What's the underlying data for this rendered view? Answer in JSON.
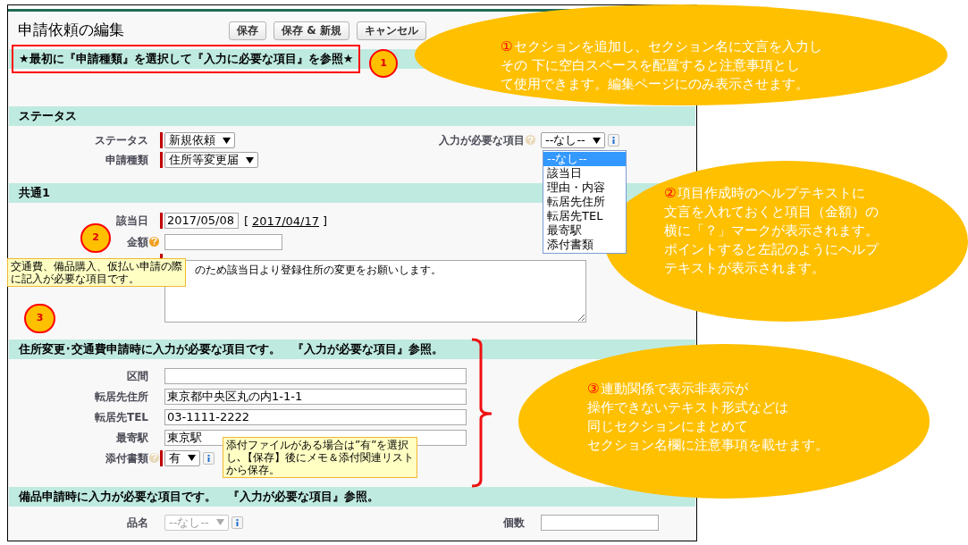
{
  "header": {
    "title": "申請依頼の編集",
    "buttons": [
      "保存",
      "保存 & 新規",
      "キャンセル"
    ]
  },
  "sections": [
    {
      "title": "★最初に『申請種類』を選択して『入力に必要な項目』を参照★",
      "highlighted": true,
      "blank_space": true
    },
    {
      "title": "ステータス",
      "highlighted": false,
      "rows": [
        {
          "left": {
            "label": "ステータス",
            "kind": "select",
            "value": "新規依頼",
            "required": true
          },
          "right": {
            "label": "入力が必要な項目",
            "kind": "select",
            "value": "--なし--",
            "help": true,
            "help_hovered": false,
            "info": true,
            "open": true,
            "options": [
              {
                "label": "--なし--",
                "selected": true
              },
              {
                "label": "該当日",
                "selected": false
              },
              {
                "label": "理由・内容",
                "selected": false
              },
              {
                "label": "転居先住所",
                "selected": false
              },
              {
                "label": "転居先TEL",
                "selected": false
              },
              {
                "label": "最寄駅",
                "selected": false
              },
              {
                "label": "添付書類",
                "selected": false
              }
            ]
          }
        },
        {
          "left": {
            "label": "申請種類",
            "kind": "select",
            "value": "住所等変更届",
            "required": true
          }
        }
      ]
    },
    {
      "title": "共通1",
      "highlighted": false,
      "rows": [
        {
          "left": {
            "label": "該当日",
            "kind": "date",
            "value": "2017/05/08",
            "required": true,
            "link": {
              "open": "[",
              "text": "2017/04/17",
              "close": "]"
            }
          }
        },
        {
          "left": {
            "label": "金額",
            "kind": "text",
            "help": true,
            "help_hovered": true
          }
        },
        {
          "left": {
            "kind": "textarea",
            "value": "のため該当日より登録住所の変更をお願いします。",
            "required": true
          }
        }
      ]
    },
    {
      "title": "住所変更･交通費申請時に入力が必要な項目です。　『入力が必要な項目』参照。",
      "highlighted": false,
      "rows": [
        {
          "left": {
            "label": "区間",
            "kind": "text"
          }
        },
        {
          "left": {
            "label": "転居先住所",
            "kind": "text",
            "value": "東京都中央区丸の内1-1-1"
          }
        },
        {
          "left": {
            "label": "転居先TEL",
            "kind": "text",
            "value": "03-1111-2222"
          }
        },
        {
          "left": {
            "label": "最寄駅",
            "kind": "text",
            "value": "東京駅"
          }
        },
        {
          "left": {
            "label": "添付書類",
            "kind": "select",
            "value": "有",
            "required": true,
            "help": true,
            "help_hovered": false,
            "info": true
          }
        }
      ]
    },
    {
      "title": "備品申請時に入力が必要な項目です。　『入力が必要な項目』参照。",
      "highlighted": false,
      "rows": [
        {
          "left": {
            "label": "品名",
            "kind": "select",
            "value": "--なし--",
            "disabled": true,
            "info": true
          },
          "right": {
            "label": "個数",
            "kind": "text"
          }
        }
      ]
    }
  ],
  "markers": [
    "1",
    "2",
    "3"
  ],
  "tooltips": [
    {
      "lines": [
        "交通費、備品購入、仮払い申請の際",
        "に記入が必要な項目です。"
      ]
    },
    {
      "lines": [
        "添付ファイルがある場合は”有”を選択",
        "し､【保存】後にメモ＆添付関連リスト",
        "から保存。"
      ]
    }
  ],
  "callouts": [
    {
      "number": "①",
      "lines": [
        "セクションを追加し、セクション名に文言を入力し",
        "その 下に空白スペースを配置すると注意事項とし",
        "て使用できます。編集ページにのみ表示させます。"
      ]
    },
    {
      "number": "②",
      "lines": [
        "項目作成時のヘルプテキストに",
        "文言を入れておくと項目（金額）の",
        "横に「？」マークが表示されます。",
        "ポイントすると左記のようにヘルプ",
        "テキストが表示されます。"
      ]
    },
    {
      "number": "③",
      "lines": [
        "連動関係で表示非表示が",
        "操作できないテキスト形式などは",
        "同じセクションにまとめて",
        "セクション名欄に注意事項を載せます。"
      ]
    }
  ]
}
